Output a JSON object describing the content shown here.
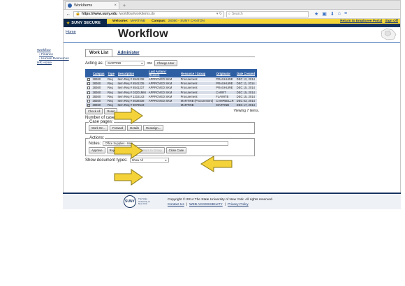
{
  "browser": {
    "tab_title": "WorkItems",
    "tab_close": "×",
    "new_tab": "+",
    "url_host": "https://www.suny.edu",
    "url_path": "/workflow/workitems.do",
    "search_placeholder": "Search"
  },
  "header": {
    "logo_text": "SUNY SECURE",
    "welcome_label": "Welcome:",
    "welcome_user": "MARTINB",
    "campus_label": "Campus:",
    "campus_value": "28360 - SUNY CANTON",
    "return_link": "Return to Employee Portal",
    "signoff_link": "Sign Off",
    "home_link": "Home",
    "page_title": "Workflow"
  },
  "leftnav": {
    "items": [
      "Workflow",
      "Finance",
      "Human Resources",
      "HR Home"
    ]
  },
  "tabs": [
    "Work List",
    "Administer"
  ],
  "acting": {
    "label": "Acting as:",
    "value": "MARTINB",
    "number": "306",
    "change_button": "Change User"
  },
  "table": {
    "headers": [
      "Campus",
      "Type",
      "Description",
      "Last Action / Reason",
      "Resource / Group",
      "Originator",
      "Date Created"
    ],
    "rows": [
      {
        "check": "",
        "campus": "28360",
        "type": "Req",
        "desc": "Item Req # 8541238",
        "action": "APPROVED SKM",
        "group": "Procurement",
        "orig": "PRASHUWE",
        "date": "DEC 12, 2014"
      },
      {
        "check": "",
        "campus": "28360",
        "type": "Req",
        "desc": "Item Req # 8541235",
        "action": "APPROVED SKM",
        "group": "Procurement",
        "orig": "PRASHUWE",
        "date": "DEC 11, 2014"
      },
      {
        "check": "",
        "campus": "28360",
        "type": "Req",
        "desc": "Item Req # 8541237",
        "action": "APPROVED SKM",
        "group": "Procurement",
        "orig": "PRASHUWE",
        "date": "DEC 15, 2014"
      },
      {
        "check": "",
        "campus": "28360",
        "type": "Req",
        "desc": "Item Req # 03201MM",
        "action": "APPROVED SKM",
        "group": "Procurement",
        "orig": "CARRT",
        "date": "DEC 15, 2014"
      },
      {
        "check": "",
        "campus": "28360",
        "type": "Req",
        "desc": "Item Req # 1215143",
        "action": "APPROVED SKM",
        "group": "Procurement",
        "orig": "FLAWITB",
        "date": "DEC 15, 2014"
      },
      {
        "check": "",
        "campus": "28360",
        "type": "Req",
        "desc": "Item Req # 8039338",
        "action": "APPROVED SKM",
        "group": "MARTINB (Procurement)",
        "orig": "CAMPBELLR",
        "date": "DEC 03, 2014"
      },
      {
        "check": "✓",
        "campus": "28360",
        "type": "Req",
        "desc": "Item Req # 9079543",
        "action": "",
        "group": "MARTINB",
        "orig": "MARTINB",
        "date": "DEC 17, 2014"
      }
    ],
    "check_all": "Check All",
    "reset": "Reset",
    "viewing": "Viewing 7 items."
  },
  "selection": {
    "count_text": "Number of cases selected: 1"
  },
  "case_pages": {
    "legend": "Case pages:",
    "buttons": [
      "Work On...",
      "Forward",
      "Details",
      "Reassign..."
    ]
  },
  "actions": {
    "legend": "Actions:",
    "notes_label": "Notes:",
    "notes_value": "Office Supplies - Item",
    "buttons": [
      "Approve",
      "Reject",
      "Cancel",
      "Return to Group",
      "Close Case"
    ]
  },
  "show_docs": {
    "label": "Show document types:",
    "value": "Show All"
  },
  "footer": {
    "seal": "SUNY",
    "seal_sub": "The State University of New York",
    "copyright": "Copyright © 2014 The State University of New York. All rights reserved.",
    "contact": "Contact Us",
    "accessibility": "WEB ACCESSIBILITY",
    "privacy": "Privacy Policy",
    "sep": "|"
  },
  "colors": {
    "arrow_fill": "#f4d23a",
    "arrow_stroke": "#8a7a18",
    "header_navy": "#17345f",
    "table_header": "#2f5fa3"
  }
}
